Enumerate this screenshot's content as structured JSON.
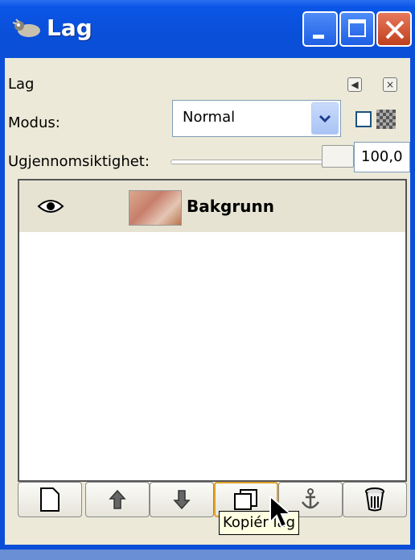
{
  "window": {
    "title": "Lag"
  },
  "panel": {
    "heading": "Lag",
    "mode_label": "Modus:",
    "mode_value": "Normal",
    "opacity_label": "Ugjennomsiktighet:",
    "opacity_value": "100,0",
    "opacity_level": 1.0
  },
  "layers": [
    {
      "name": "Bakgrunn",
      "visible": true,
      "icon": "eye-icon"
    }
  ],
  "toolbar": [
    {
      "name": "new-layer",
      "icon": "page-icon"
    },
    {
      "name": "raise-layer",
      "icon": "arrow-up-icon"
    },
    {
      "name": "lower-layer",
      "icon": "arrow-down-icon"
    },
    {
      "name": "duplicate-layer",
      "icon": "duplicate-icon"
    },
    {
      "name": "anchor-layer",
      "icon": "anchor-icon"
    },
    {
      "name": "delete-layer",
      "icon": "trash-icon"
    }
  ],
  "tooltip": {
    "text": "Kopiér lag"
  },
  "colors": {
    "titlebar": "#0b4fd8",
    "panel": "#ece9d8",
    "tooltip": "#ffffe1",
    "close": "#c0401e"
  }
}
